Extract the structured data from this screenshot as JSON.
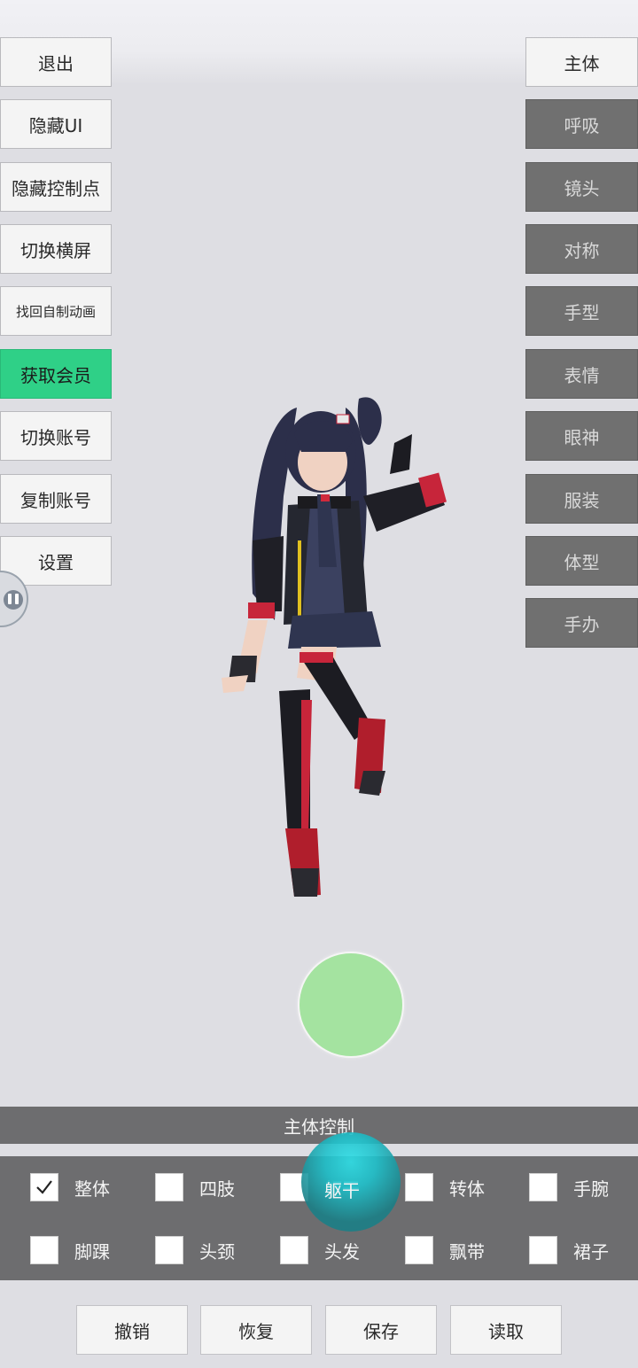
{
  "left_menu": [
    {
      "id": "exit",
      "label": "退出",
      "style": "light"
    },
    {
      "id": "hide-ui",
      "label": "隐藏UI",
      "style": "light"
    },
    {
      "id": "hide-control-points",
      "label": "隐藏控制点",
      "style": "light"
    },
    {
      "id": "toggle-landscape",
      "label": "切换横屏",
      "style": "light"
    },
    {
      "id": "recover-animation",
      "label": "找回自制动画",
      "style": "light"
    },
    {
      "id": "get-membership",
      "label": "获取会员",
      "style": "green"
    },
    {
      "id": "switch-account",
      "label": "切换账号",
      "style": "light"
    },
    {
      "id": "copy-account",
      "label": "复制账号",
      "style": "light"
    },
    {
      "id": "settings",
      "label": "设置",
      "style": "light"
    }
  ],
  "right_menu": [
    {
      "id": "body",
      "label": "主体",
      "style": "light"
    },
    {
      "id": "breath",
      "label": "呼吸",
      "style": "dark"
    },
    {
      "id": "camera",
      "label": "镜头",
      "style": "dark"
    },
    {
      "id": "symmetry",
      "label": "对称",
      "style": "dark"
    },
    {
      "id": "hand-shape",
      "label": "手型",
      "style": "dark"
    },
    {
      "id": "expression",
      "label": "表情",
      "style": "dark"
    },
    {
      "id": "eye-look",
      "label": "眼神",
      "style": "dark"
    },
    {
      "id": "costume",
      "label": "服装",
      "style": "dark"
    },
    {
      "id": "body-shape",
      "label": "体型",
      "style": "dark"
    },
    {
      "id": "figure",
      "label": "手办",
      "style": "dark"
    }
  ],
  "panel": {
    "title": "主体控制",
    "checkboxes": [
      {
        "label": "整体",
        "checked": true
      },
      {
        "label": "四肢",
        "checked": false
      },
      {
        "label": "躯干",
        "checked": false
      },
      {
        "label": "转体",
        "checked": false
      },
      {
        "label": "手腕",
        "checked": false
      },
      {
        "label": "脚踝",
        "checked": false
      },
      {
        "label": "头颈",
        "checked": false
      },
      {
        "label": "头发",
        "checked": false
      },
      {
        "label": "飘带",
        "checked": false
      },
      {
        "label": "裙子",
        "checked": false
      }
    ]
  },
  "bottom_bar": [
    {
      "id": "undo",
      "label": "撤销"
    },
    {
      "id": "redo",
      "label": "恢复"
    },
    {
      "id": "save",
      "label": "保存"
    },
    {
      "id": "load",
      "label": "读取"
    }
  ],
  "colors": {
    "background": "#dedee3",
    "accent_green": "#2fd087",
    "panel_gray": "#6d6d6f",
    "joystick_green": "#a4e3a0",
    "cyan_marker": "#1fc2cc"
  }
}
